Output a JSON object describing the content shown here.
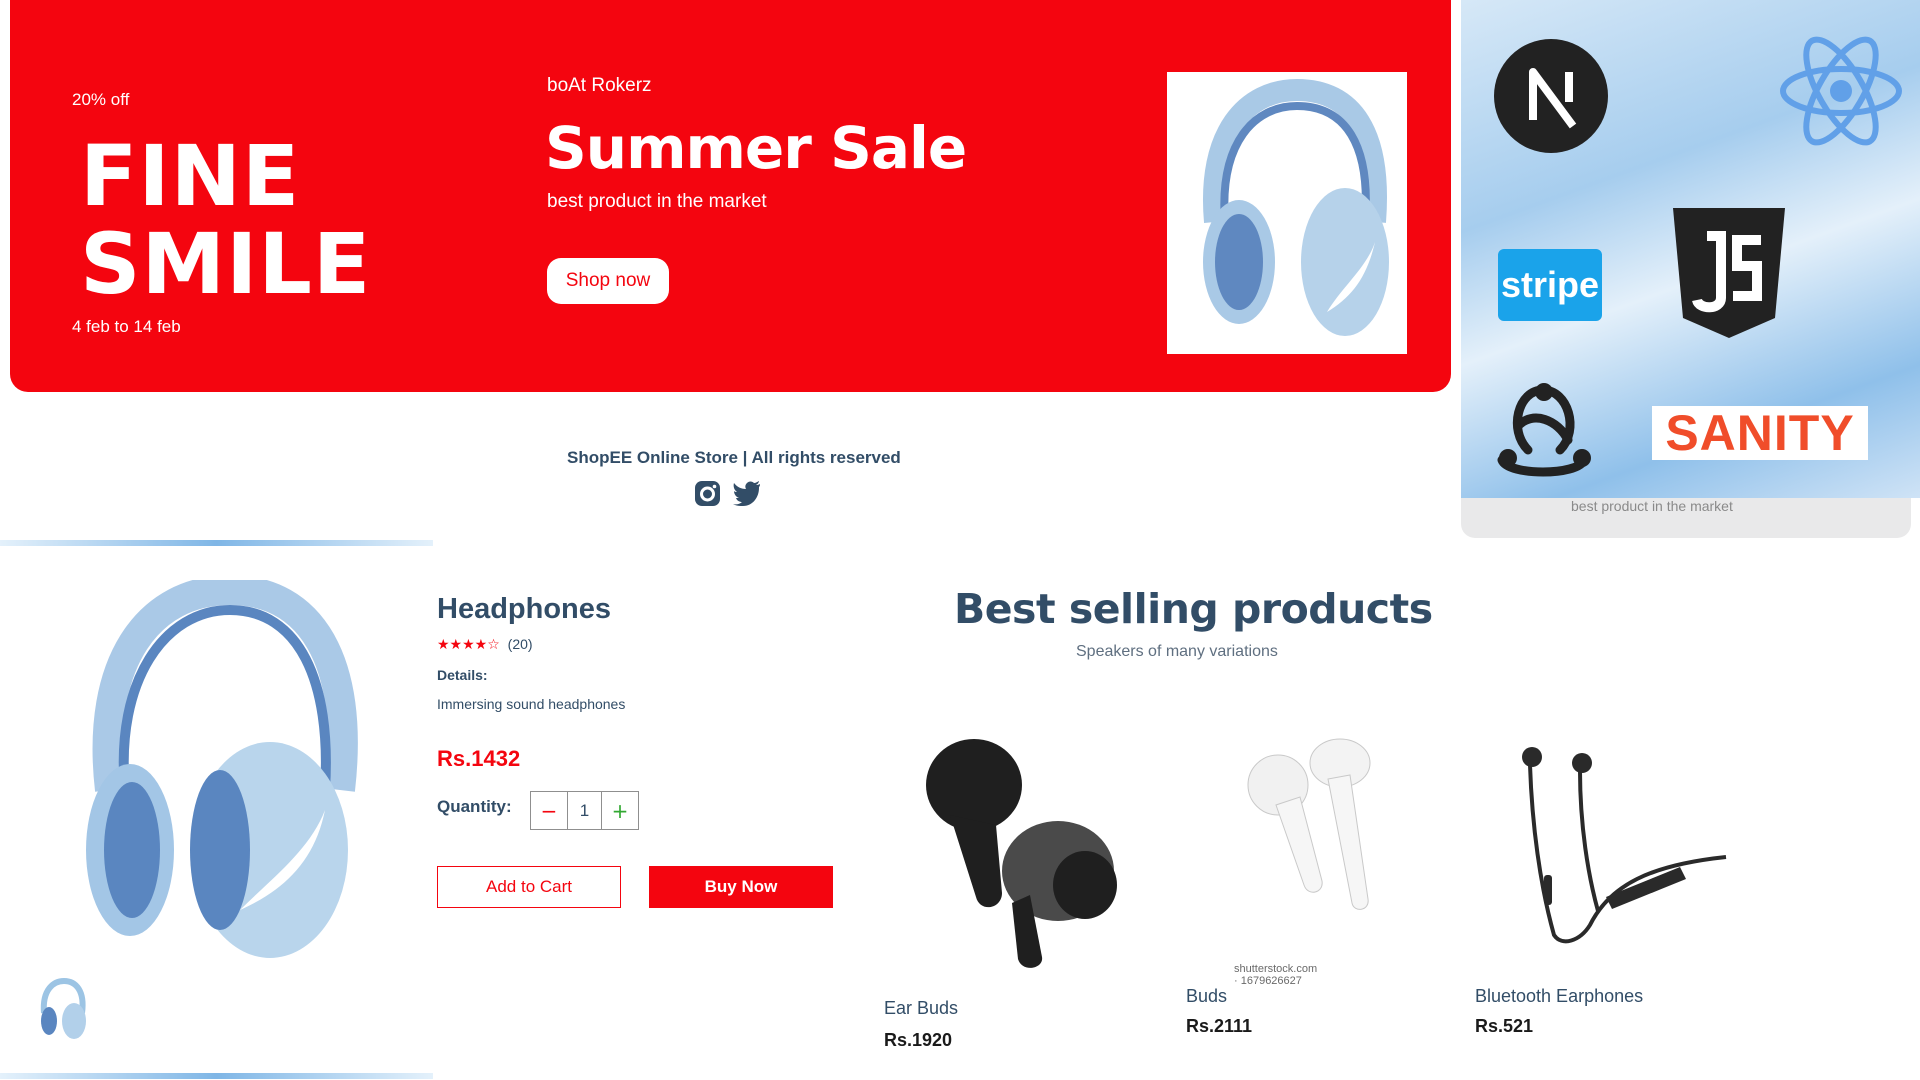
{
  "hero": {
    "discount": "20% off",
    "large_text_1": "FINE",
    "large_text_2": "SMILE",
    "sale_time": "4 feb to 14 feb",
    "small_text": "boAt Rokerz",
    "mid_text": "Summer Sale",
    "desc": "best product in the market",
    "button_text": "Shop now"
  },
  "tech_logos": {
    "stripe": "stripe",
    "sanity": "SANITY",
    "shade_text": "best product in the market",
    "icons": [
      "nextjs-icon",
      "react-icon",
      "stripe-icon",
      "javascript-icon",
      "redux-icon",
      "sanity-icon"
    ]
  },
  "footer": {
    "text": "ShopEE Online Store | All rights reserved",
    "icons": [
      "instagram-icon",
      "twitter-icon"
    ]
  },
  "product_detail": {
    "name": "Headphones",
    "stars": "★★★★☆",
    "rating_count": "(20)",
    "details_label": "Details:",
    "details": "Immersing sound headphones",
    "price": "Rs.1432",
    "quantity_label": "Quantity:",
    "quantity_minus": "−",
    "quantity": "1",
    "quantity_plus": "+",
    "add_to_cart": "Add to Cart",
    "buy_now": "Buy Now"
  },
  "best_selling": {
    "title": "Best selling products",
    "subtitle": "Speakers of many variations",
    "products": [
      {
        "name": "Ear Buds",
        "price": "Rs.1920"
      },
      {
        "name": "Buds",
        "price": "Rs.2111"
      },
      {
        "name": "Bluetooth Earphones",
        "price": "Rs.521"
      }
    ],
    "watermark": "shutterstock.com · 1679626627"
  },
  "colors": {
    "accent_red": "#f4050f",
    "text_dark": "#324d67",
    "headphone_blue": "#9cc4e4"
  }
}
